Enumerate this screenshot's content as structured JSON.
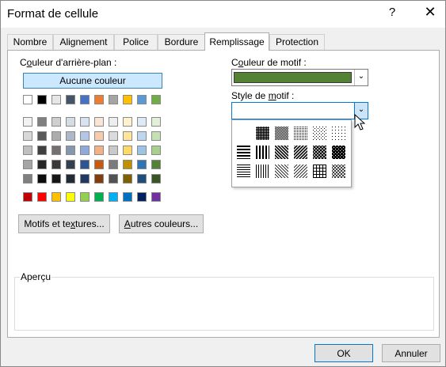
{
  "window": {
    "title": "Format de cellule",
    "help_label": "?",
    "close_label": "✕"
  },
  "tabs": [
    {
      "label": "Nombre"
    },
    {
      "label": "Alignement"
    },
    {
      "label": "Police"
    },
    {
      "label": "Bordure"
    },
    {
      "label": "Remplissage",
      "active": true
    },
    {
      "label": "Protection"
    }
  ],
  "background": {
    "label_prefix": "C",
    "label_access": "o",
    "label_rest": "uleur d'arrière-plan :",
    "no_color_label": "Aucune couleur",
    "theme_row": [
      "#ffffff",
      "#000000",
      "#e7e6e6",
      "#44546a",
      "#4472c4",
      "#ed7d31",
      "#a5a5a5",
      "#ffc000",
      "#5b9bd5",
      "#70ad47"
    ],
    "shade_rows": [
      [
        "#f2f2f2",
        "#7f7f7f",
        "#d0cece",
        "#d6dce4",
        "#d9e2f3",
        "#fbe5d5",
        "#ededed",
        "#fff2cc",
        "#deebf6",
        "#e2efd9"
      ],
      [
        "#d8d8d8",
        "#595959",
        "#aeabab",
        "#adb9ca",
        "#b4c6e7",
        "#f7cbac",
        "#dbdbdb",
        "#fee599",
        "#bdd7ee",
        "#c5e0b3"
      ],
      [
        "#bfbfbf",
        "#3f3f3f",
        "#757070",
        "#8496b0",
        "#8eaadb",
        "#f4b183",
        "#c9c9c9",
        "#ffd965",
        "#9cc3e5",
        "#a8d08d"
      ],
      [
        "#a5a5a5",
        "#262626",
        "#3a3838",
        "#323f4f",
        "#2f5496",
        "#c55a11",
        "#7b7b7b",
        "#bf9000",
        "#2e75b5",
        "#538135"
      ],
      [
        "#7f7f7f",
        "#0c0c0c",
        "#171616",
        "#222a35",
        "#1f3864",
        "#833c0b",
        "#525252",
        "#7f6000",
        "#1e4e79",
        "#375623"
      ]
    ],
    "standard_row": [
      "#c00000",
      "#ff0000",
      "#ffc000",
      "#ffff00",
      "#92d050",
      "#00b050",
      "#00b0f0",
      "#0070c0",
      "#002060",
      "#7030a0"
    ]
  },
  "pattern_color": {
    "label_prefix": "C",
    "label_access": "o",
    "label_rest": "uleur de motif :",
    "value_color": "#548235"
  },
  "pattern_style": {
    "label_prefix": "Style de ",
    "label_access": "m",
    "label_rest": "otif :",
    "patterns": [
      [
        "none",
        "dark-gray",
        "medium-gray",
        "light-gray",
        "gray-12",
        "gray-6"
      ],
      [
        "horizontal-stripe",
        "vertical-stripe",
        "reverse-diagonal-stripe",
        "diagonal-stripe",
        "diagonal-crosshatch",
        "thick-diagonal-crosshatch"
      ],
      [
        "thin-horizontal-stripe",
        "thin-vertical-stripe",
        "thin-reverse-diagonal-stripe",
        "thin-diagonal-stripe",
        "thin-horizontal-crosshatch",
        "thin-diagonal-crosshatch"
      ]
    ]
  },
  "buttons": {
    "fill_effects_prefix": "Motifs et te",
    "fill_effects_access": "x",
    "fill_effects_rest": "tures...",
    "more_colors_prefix": "",
    "more_colors_access": "A",
    "more_colors_rest": "utres couleurs...",
    "ok_label": "OK",
    "cancel_label": "Annuler"
  },
  "preview": {
    "label": "Aperçu"
  }
}
